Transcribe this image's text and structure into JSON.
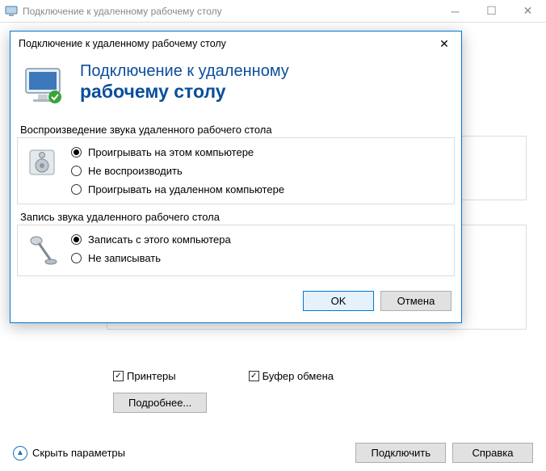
{
  "parent_window": {
    "title": "Подключение к удаленному рабочему столу",
    "checkbox_printers": "Принтеры",
    "checkbox_clipboard": "Буфер обмена",
    "more_button": "Подробнее...",
    "collapse_link": "Скрыть параметры",
    "connect_button": "Подключить",
    "help_button": "Справка"
  },
  "modal": {
    "title": "Подключение к удаленному рабочему столу",
    "banner_line1": "Подключение к удаленному",
    "banner_line2": "рабочему столу",
    "playback_group": {
      "title": "Воспроизведение звука удаленного рабочего стола",
      "option_local": "Проигрывать на этом компьютере",
      "option_none": "Не воспроизводить",
      "option_remote": "Проигрывать на удаленном компьютере"
    },
    "record_group": {
      "title": "Запись звука удаленного рабочего стола",
      "option_record": "Записать с этого компьютера",
      "option_no_record": "Не записывать"
    },
    "ok": "OK",
    "cancel": "Отмена"
  }
}
